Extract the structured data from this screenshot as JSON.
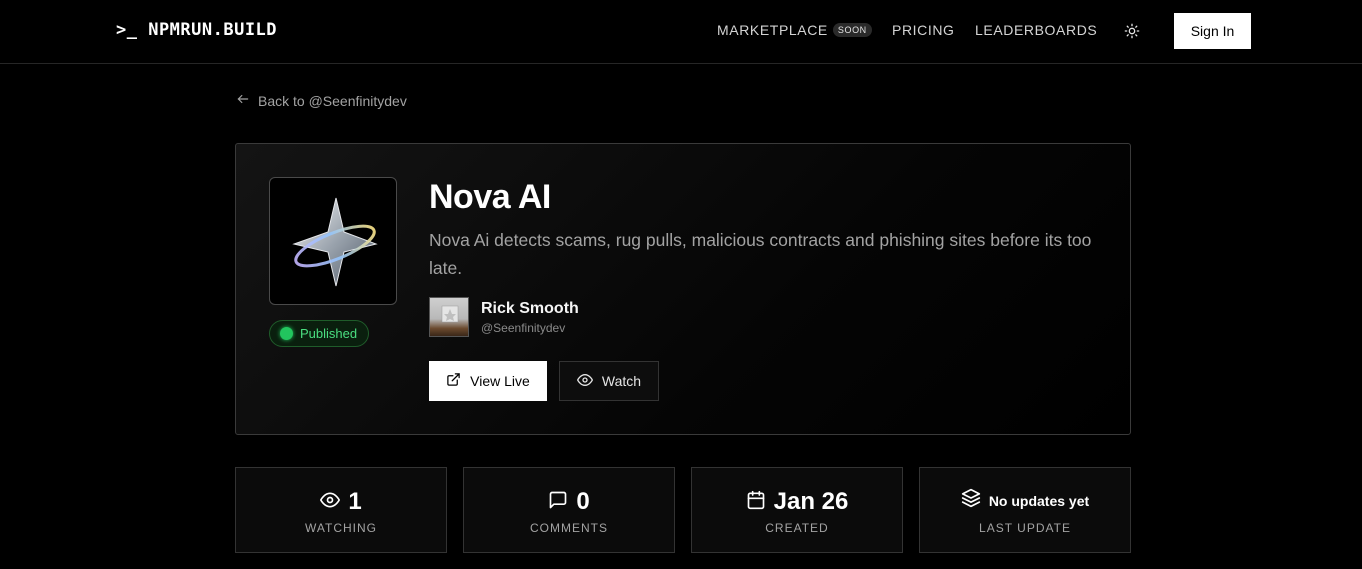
{
  "header": {
    "logo": ">_ NPMRUN.BUILD",
    "nav": {
      "marketplace": "MARKETPLACE",
      "soon_badge": "SOON",
      "pricing": "PRICING",
      "leaderboards": "LEADERBOARDS"
    },
    "theme_icon": "sun-icon",
    "sign_in": "Sign In"
  },
  "back_link": "Back to @Seenfinitydev",
  "project": {
    "title": "Nova AI",
    "description": "Nova Ai detects scams, rug pulls, malicious contracts and phishing sites before its too late.",
    "status": "Published",
    "status_color": "#22c55e",
    "author": {
      "name": "Rick Smooth",
      "handle": "@Seenfinitydev"
    },
    "actions": {
      "view_live": "View Live",
      "watch": "Watch"
    }
  },
  "stats": [
    {
      "icon": "eye-icon",
      "value": "1",
      "label": "WATCHING"
    },
    {
      "icon": "comment-icon",
      "value": "0",
      "label": "COMMENTS"
    },
    {
      "icon": "calendar-icon",
      "value": "Jan 26",
      "label": "CREATED"
    },
    {
      "icon": "layers-icon",
      "value": "No updates yet",
      "label": "LAST UPDATE"
    }
  ]
}
